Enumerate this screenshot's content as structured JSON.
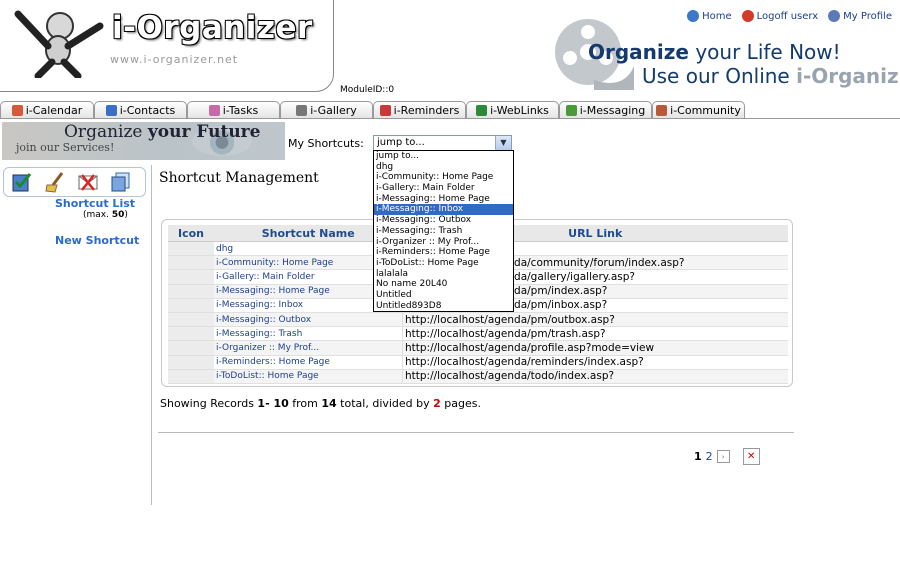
{
  "header": {
    "logo_text": "i-Organizer",
    "logo_url": "www.i-organizer.net",
    "module_id": "ModuleID::0",
    "links": [
      {
        "label": "Home"
      },
      {
        "label": "Logoff userx"
      },
      {
        "label": "My Profile"
      }
    ],
    "slogan_line1_bold": "Organize",
    "slogan_line1_rest": " your Life Now!",
    "slogan_line2": "Use our Online ",
    "slogan_line2_bold": "i-Organiz"
  },
  "tabs": [
    {
      "label": "i-Calendar",
      "color": "#d45a3a"
    },
    {
      "label": "i-Contacts",
      "color": "#3a6fc8"
    },
    {
      "label": "i-Tasks",
      "color": "#c86aa8"
    },
    {
      "label": "i-Gallery",
      "color": "#777777"
    },
    {
      "label": "i-Reminders",
      "color": "#c83a3a"
    },
    {
      "label": "i-WebLinks",
      "color": "#2a8a3a"
    },
    {
      "label": "i-Messaging",
      "color": "#4a9a3a"
    },
    {
      "label": "i-Community",
      "color": "#b85a3a"
    }
  ],
  "banner": {
    "line1": "Organize ",
    "line1_bold": "your Future",
    "line2": "join our Services!"
  },
  "shortcuts": {
    "label": "My Shortcuts:",
    "selected": "jump to...",
    "options": [
      "jump to...",
      "dhg",
      "i-Community:: Home Page",
      "i-Gallery:: Main Folder",
      "i-Messaging:: Home Page",
      "i-Messaging:: Inbox",
      "i-Messaging:: Outbox",
      "i-Messaging:: Trash",
      "i-Organizer :: My Prof...",
      "i-Reminders:: Home Page",
      "i-ToDoList:: Home Page",
      "lalalala",
      "No name 20L40",
      "Untitled",
      "Untitled893D8"
    ],
    "highlighted_index": 5
  },
  "sidebar": {
    "list_link": "Shortcut List",
    "max_prefix": "(max. ",
    "max_value": "50",
    "max_suffix": ")",
    "new_link": "New Shortcut"
  },
  "main": {
    "title": "Shortcut Management",
    "columns": [
      "Icon",
      "Shortcut Name",
      "URL Link"
    ],
    "rows": [
      {
        "name": "dhg",
        "url": ""
      },
      {
        "name": "i-Community:: Home Page",
        "url": "http://localhost/agenda/community/forum/index.asp?"
      },
      {
        "name": "i-Gallery:: Main Folder",
        "url": "http://localhost/agenda/gallery/igallery.asp?"
      },
      {
        "name": "i-Messaging:: Home Page",
        "url": "http://localhost/agenda/pm/index.asp?"
      },
      {
        "name": "i-Messaging:: Inbox",
        "url": "http://localhost/agenda/pm/inbox.asp?"
      },
      {
        "name": "i-Messaging:: Outbox",
        "url": "http://localhost/agenda/pm/outbox.asp?"
      },
      {
        "name": "i-Messaging:: Trash",
        "url": "http://localhost/agenda/pm/trash.asp?"
      },
      {
        "name": "i-Organizer :: My Prof...",
        "url": "http://localhost/agenda/profile.asp?mode=view"
      },
      {
        "name": "i-Reminders:: Home Page",
        "url": "http://localhost/agenda/reminders/index.asp?"
      },
      {
        "name": "i-ToDoList:: Home Page",
        "url": "http://localhost/agenda/todo/index.asp?"
      }
    ],
    "records": {
      "prefix": "Showing Records ",
      "range": "1- 10",
      "mid": " from ",
      "total": "14",
      "mid2": " total, divided by ",
      "pages": "2",
      "suffix": " pages."
    },
    "pager": {
      "current": "1",
      "next": "2"
    }
  }
}
